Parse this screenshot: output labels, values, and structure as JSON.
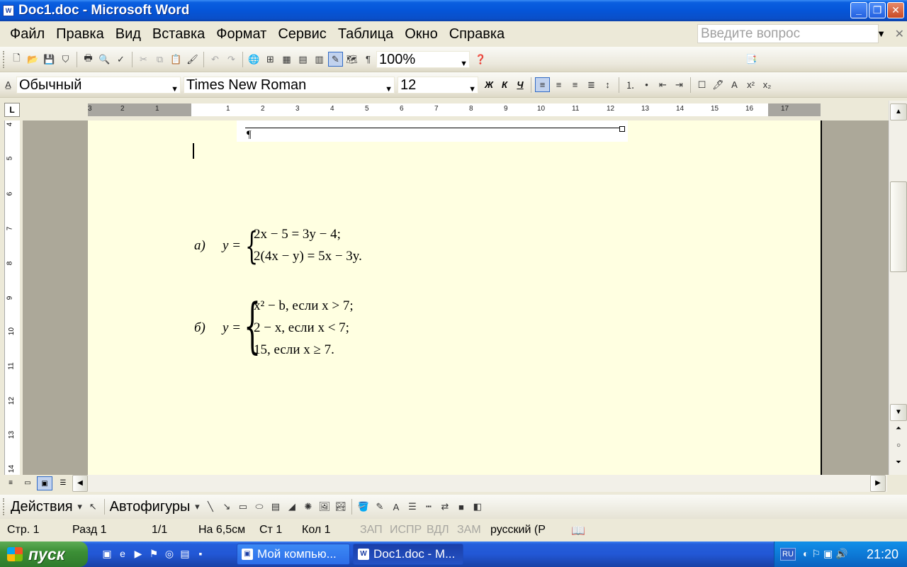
{
  "window": {
    "title": "Doc1.doc - Microsoft Word",
    "app_icon_label": "W"
  },
  "menu": {
    "items": [
      "Файл",
      "Правка",
      "Вид",
      "Вставка",
      "Формат",
      "Сервис",
      "Таблица",
      "Окно",
      "Справка"
    ],
    "ask_placeholder": "Введите вопрос"
  },
  "standard_toolbar": {
    "zoom": "100%",
    "pilcrow": "¶"
  },
  "formatting_toolbar": {
    "style": "Обычный",
    "font": "Times New Roman",
    "size": "12",
    "bold": "Ж",
    "italic": "К",
    "underline": "Ч"
  },
  "ruler": {
    "corner": "L",
    "horizontal_ticks": [
      "3",
      "2",
      "1",
      "1",
      "2",
      "3",
      "4",
      "5",
      "6",
      "7",
      "8",
      "9",
      "10",
      "11",
      "12",
      "13",
      "14",
      "15",
      "16",
      "17"
    ],
    "vertical_ticks": [
      "4",
      "5",
      "6",
      "7",
      "8",
      "9",
      "10",
      "11",
      "12",
      "13",
      "14"
    ]
  },
  "document": {
    "frame_pilcrow": "¶",
    "eq_a": {
      "label": "а)",
      "lhs": "y =",
      "line1": "2x − 5 = 3y − 4;",
      "line2": "2(4x − y) = 5x − 3y."
    },
    "eq_b": {
      "label": "б)",
      "lhs": "y =",
      "line1": "x² − b, если x > 7;",
      "line2": "2 − x, если x < 7;",
      "line3": "15, если x ≥ 7."
    }
  },
  "drawing_toolbar": {
    "actions": "Действия",
    "autoshapes": "Автофигуры"
  },
  "status": {
    "page": "Стр. 1",
    "section": "Разд 1",
    "pages": "1/1",
    "at": "На 6,5см",
    "line": "Ст 1",
    "col": "Кол 1",
    "rec": "ЗАП",
    "trk": "ИСПР",
    "ext": "ВДЛ",
    "ovr": "ЗАМ",
    "lang": "русский (Р"
  },
  "taskbar": {
    "start": "пуск",
    "tasks": [
      "Мой компью...",
      "Doc1.doc - M..."
    ],
    "lang": "RU",
    "clock": "21:20"
  },
  "colors": {
    "titlebar": "#0555d8",
    "page_bg": "#ffffe1",
    "taskbar": "#2257d5",
    "start": "#3c8f36"
  }
}
